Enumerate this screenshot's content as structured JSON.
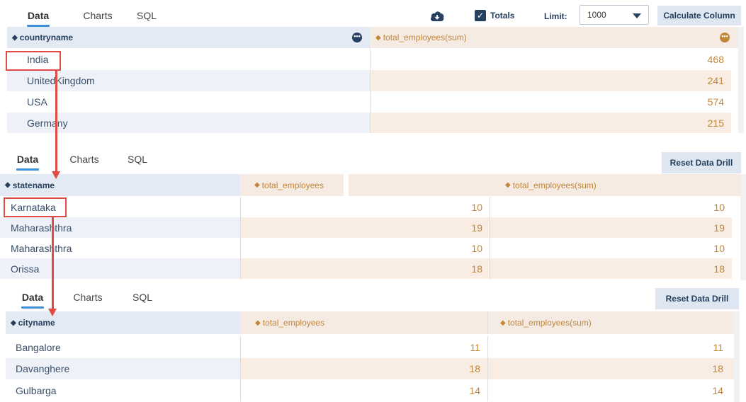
{
  "panel1": {
    "tabs": [
      "Data",
      "Charts",
      "SQL"
    ],
    "totals_label": "Totals",
    "limit_label": "Limit:",
    "limit_value": "1000",
    "calculate_button": "Calculate Column",
    "columns": [
      "countryname",
      "total_employees(sum)"
    ],
    "rows": [
      {
        "name": "India",
        "value": "468"
      },
      {
        "name": "UnitedKingdom",
        "value": "241"
      },
      {
        "name": "USA",
        "value": "574"
      },
      {
        "name": "Germany",
        "value": "215"
      }
    ]
  },
  "panel2": {
    "tabs": [
      "Data",
      "Charts",
      "SQL"
    ],
    "reset_button": "Reset Data Drill",
    "columns": [
      "statename",
      "total_employees",
      "total_employees(sum)"
    ],
    "rows": [
      {
        "name": "Karnataka",
        "v1": "10",
        "v2": "10"
      },
      {
        "name": "Maharashthra",
        "v1": "19",
        "v2": "19"
      },
      {
        "name": "Maharashthra",
        "v1": "10",
        "v2": "10"
      },
      {
        "name": "Orissa",
        "v1": "18",
        "v2": "18"
      }
    ]
  },
  "panel3": {
    "tabs": [
      "Data",
      "Charts",
      "SQL"
    ],
    "reset_button": "Reset Data Drill",
    "columns": [
      "cityname",
      "total_employees",
      "total_employees(sum)"
    ],
    "rows": [
      {
        "name": "Bangalore",
        "v1": "11",
        "v2": "11"
      },
      {
        "name": "Davanghere",
        "v1": "18",
        "v2": "18"
      },
      {
        "name": "Gulbarga",
        "v1": "14",
        "v2": "14"
      }
    ]
  },
  "colors": {
    "header_blue": "#e3eaf4",
    "header_peach": "#f6ebe2",
    "metric_text": "#c0873b",
    "tab_underline": "#3d8fd8",
    "highlight_red": "#e04c44",
    "navy": "#26405f"
  }
}
